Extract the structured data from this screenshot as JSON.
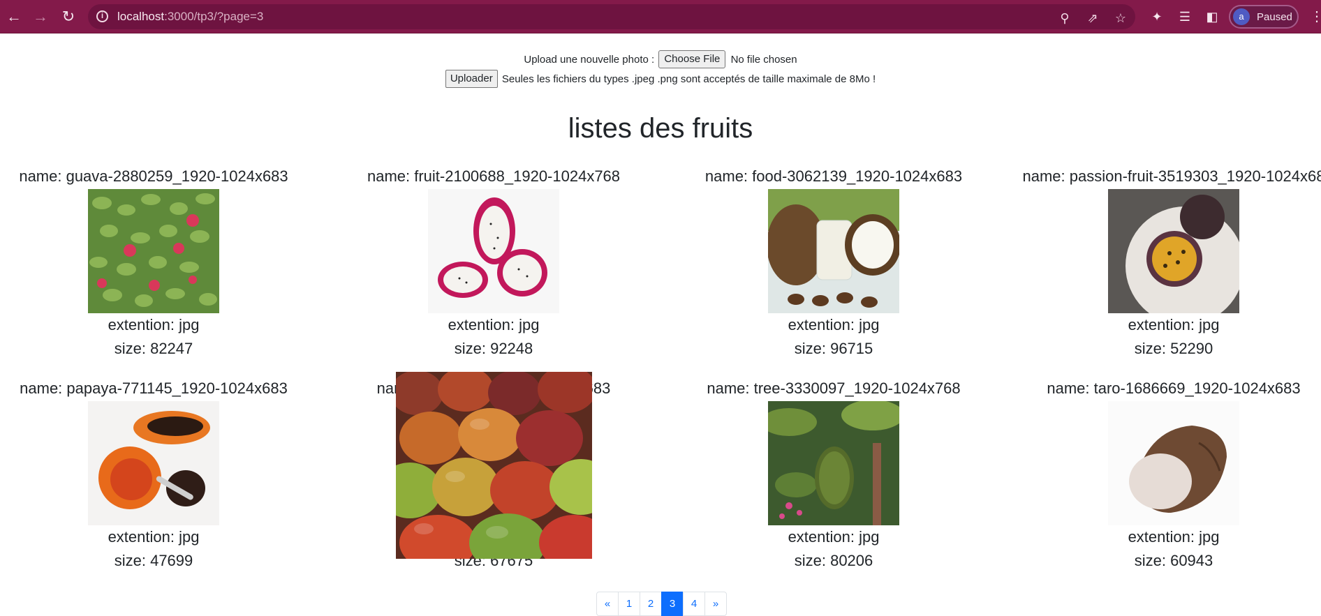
{
  "browser": {
    "url_host": "localhost",
    "url_rest": ":3000/tp3/?page=3",
    "profile_initial": "a",
    "profile_status": "Paused"
  },
  "upload": {
    "label": "Upload une nouvelle photo :",
    "choose_label": "Choose File",
    "file_status": "No file chosen",
    "submit_label": "Uploader",
    "note": "Seules les fichiers du types .jpeg .png sont acceptés de taille maximale de 8Mo !"
  },
  "title": "listes des fruits",
  "fruits": [
    {
      "name": "name: guava-2880259_1920-1024x683",
      "ext": "extention: jpg",
      "size": "size: 82247"
    },
    {
      "name": "name: fruit-2100688_1920-1024x768",
      "ext": "extention: jpg",
      "size": "size: 92248"
    },
    {
      "name": "name: food-3062139_1920-1024x683",
      "ext": "extention: jpg",
      "size": "size: 96715"
    },
    {
      "name": "name: passion-fruit-3519303_1920-1024x68",
      "ext": "extention: jpg",
      "size": "size: 52290"
    },
    {
      "name": "name: papaya-771145_1920-1024x683",
      "ext": "extention: jpg",
      "size": "size: 47699"
    },
    {
      "name": "name",
      "name_tail": "x683",
      "ext": "",
      "size": "size: 67675"
    },
    {
      "name": "name: tree-3330097_1920-1024x768",
      "ext": "extention: jpg",
      "size": "size: 80206"
    },
    {
      "name": "name: taro-1686669_1920-1024x683",
      "ext": "extention: jpg",
      "size": "size: 60943"
    }
  ],
  "pagination": {
    "prev": "«",
    "pages": [
      "1",
      "2",
      "3",
      "4"
    ],
    "active": "3",
    "next": "»"
  }
}
